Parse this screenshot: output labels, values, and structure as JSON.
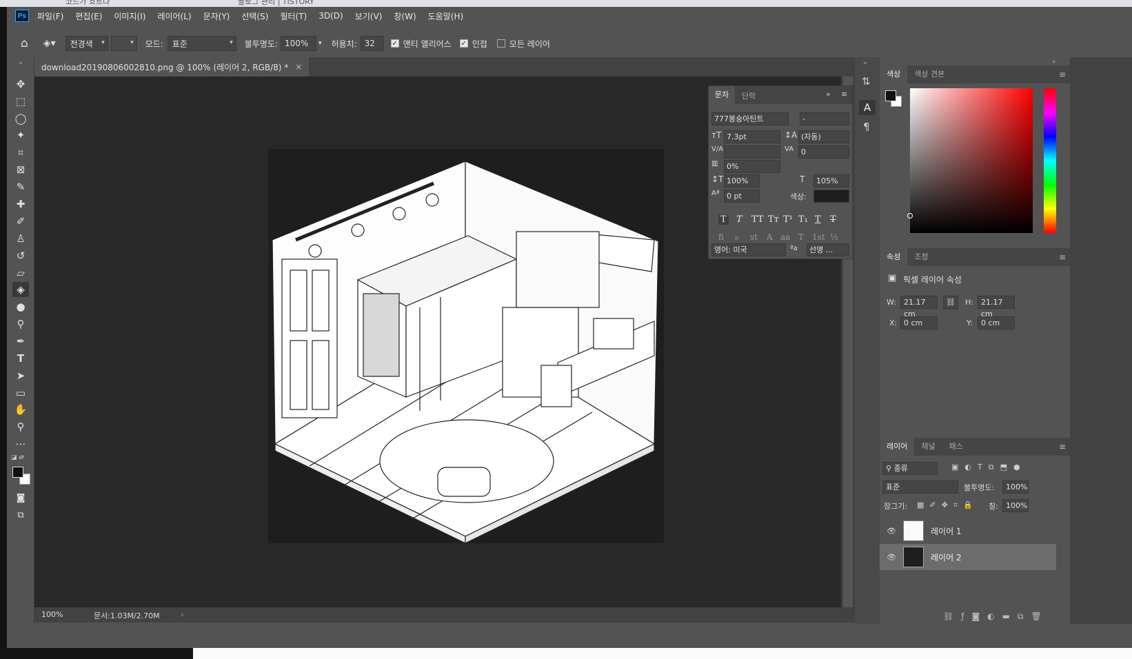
{
  "browser": {
    "tabs": [
      "코드가 흐르다",
      "블로그 관리 | TISTORY"
    ]
  },
  "app": {
    "logo": "Ps"
  },
  "menu": [
    "파일(F)",
    "편집(E)",
    "이미지(I)",
    "레이어(L)",
    "문자(Y)",
    "선택(S)",
    "필터(T)",
    "3D(D)",
    "보기(V)",
    "창(W)",
    "도움말(H)"
  ],
  "options": {
    "fill_source": "전경색",
    "mode_label": "모드:",
    "mode_value": "표준",
    "opacity_label": "불투명도:",
    "opacity_value": "100%",
    "tolerance_label": "허용치:",
    "tolerance_value": "32",
    "antialias_label": "앤티 앨리어스",
    "antialias_checked": true,
    "contiguous_label": "인접",
    "contiguous_checked": true,
    "all_layers_label": "모든 레이어",
    "all_layers_checked": false
  },
  "document": {
    "tab_title": "download20190806002810.png @ 100% (레이어 2, RGB/8) *",
    "close": "×"
  },
  "status": {
    "zoom": "100%",
    "doc_info": "문서:1.03M/2.70M"
  },
  "tools": [
    "move-tool-icon",
    "marquee-tool-icon",
    "lasso-tool-icon",
    "magic-wand-icon",
    "crop-tool-icon",
    "frame-tool-icon",
    "eyedropper-icon",
    "healing-brush-icon",
    "brush-tool-icon",
    "stamp-tool-icon",
    "history-brush-icon",
    "eraser-icon",
    "paint-bucket-icon",
    "blur-tool-icon",
    "dodge-tool-icon",
    "pen-tool-icon",
    "type-tool-icon",
    "path-select-icon",
    "rectangle-tool-icon",
    "hand-tool-icon",
    "zoom-tool-icon",
    "more-tools-icon"
  ],
  "character": {
    "tab_char": "문자",
    "tab_para": "단락",
    "font_family": "777봉숭아틴트",
    "font_style": "-",
    "size": "7.3pt",
    "leading": "(자동)",
    "kerning": "",
    "tracking": "0",
    "scale_pct": "0%",
    "vscale": "100%",
    "hscale": "105%",
    "baseline": "0 pt",
    "color_label": "색상:",
    "language": "영어: 미국",
    "antialias": "선명 ..."
  },
  "color_panel": {
    "tab_color": "색상",
    "tab_swatch": "색상 견본",
    "accent": "#31a8ff"
  },
  "properties": {
    "tab_props": "속성",
    "tab_adjust": "조정",
    "title": "픽셀 레이어 속성",
    "w_label": "W:",
    "w_value": "21.17 cm",
    "h_label": "H:",
    "h_value": "21.17 cm",
    "x_label": "X:",
    "x_value": "0 cm",
    "y_label": "Y:",
    "y_value": "0 cm"
  },
  "layers": {
    "tab_layers": "레이어",
    "tab_channels": "채널",
    "tab_paths": "패스",
    "filter_kind": "종류",
    "blend_mode": "표준",
    "opacity_label": "불투명도:",
    "opacity_value": "100%",
    "lock_label": "잠그기:",
    "fill_label": "칠:",
    "fill_value": "100%",
    "items": [
      {
        "name": "레이어 1"
      },
      {
        "name": "레이어 2"
      }
    ]
  }
}
